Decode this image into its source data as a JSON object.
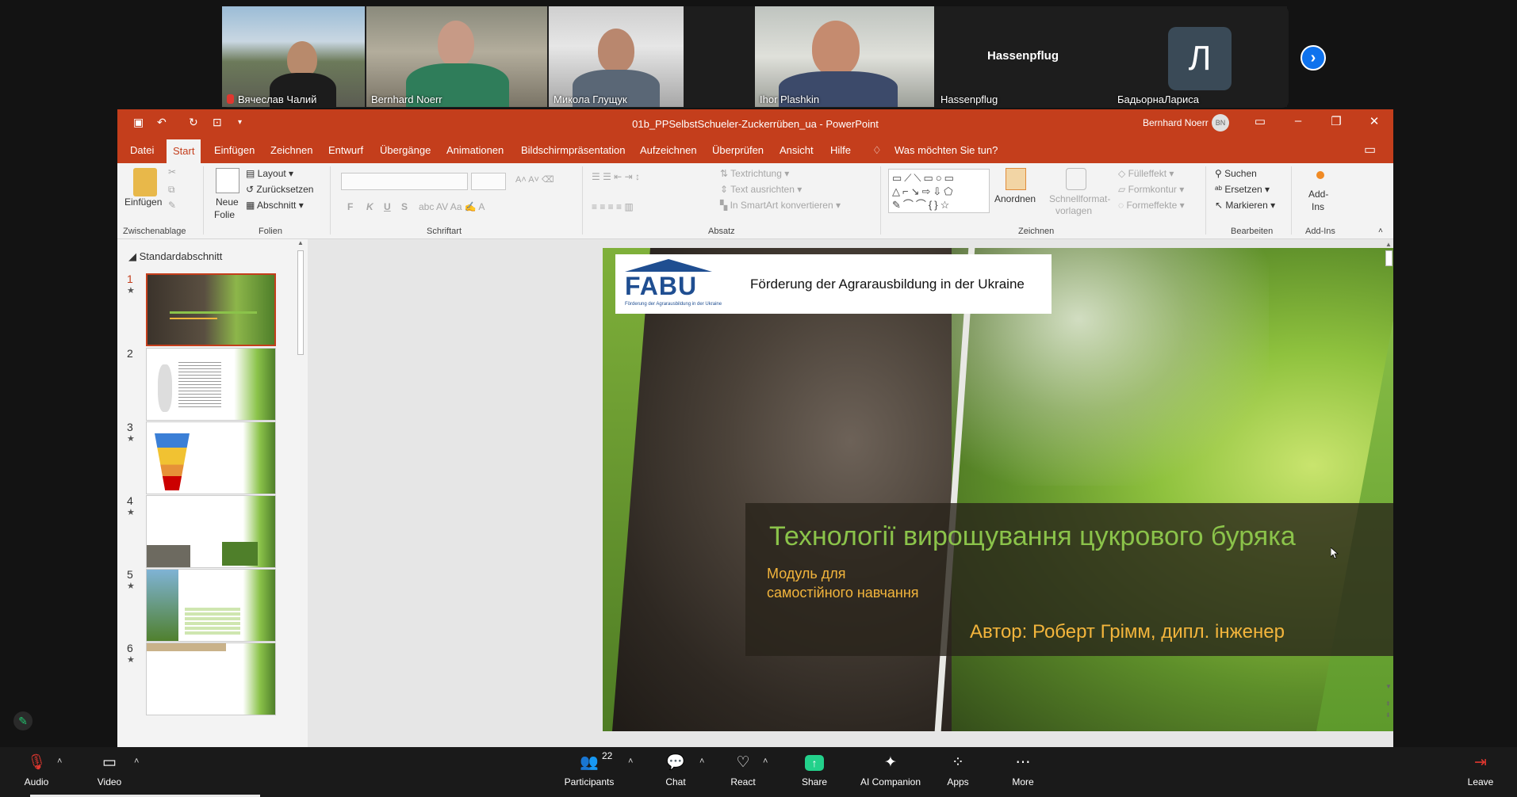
{
  "participants": [
    {
      "name": "Вячеслав Чалий",
      "muted": true
    },
    {
      "name": "Bernhard Noerr"
    },
    {
      "name": "Микола Глущук"
    },
    {
      "name": "Ihor Plashkin",
      "active_speaker": true
    },
    {
      "name": "Hassenpflug",
      "display": "Hassenpflug"
    },
    {
      "name": "БадьорнаЛариса",
      "avatar_letter": "Л"
    }
  ],
  "strip_next_icon": "chevron-right-icon",
  "powerpoint": {
    "doc_title": "01b_PPSelbstSchueler-Zuckerrüben_ua  -  PowerPoint",
    "user": "Bernhard Noerr",
    "user_initials": "BN",
    "tabs": [
      "Datei",
      "Start",
      "Einfügen",
      "Zeichnen",
      "Entwurf",
      "Übergänge",
      "Animationen",
      "Bildschirmpräsentation",
      "Aufzeichnen",
      "Überprüfen",
      "Ansicht",
      "Hilfe"
    ],
    "selected_tab": "Start",
    "tell_me": "Was möchten Sie tun?",
    "ribbon": {
      "paste": "Einfügen",
      "clipboard_group": "Zwischenablage",
      "new_slide_1": "Neue",
      "new_slide_2": "Folie",
      "layout": "Layout",
      "reset": "Zurücksetzen",
      "section": "Abschnitt",
      "slides_group": "Folien",
      "font_group": "Schriftart",
      "bold": "F",
      "italic": "K",
      "underline": "U",
      "strike": "S",
      "text_direction": "Textrichtung",
      "align_text": "Text ausrichten",
      "smartart": "In SmartArt konvertieren",
      "paragraph_group": "Absatz",
      "arrange": "Anordnen",
      "quick_styles_1": "Schnellformat-",
      "quick_styles_2": "vorlagen",
      "fill": "Fülleffekt",
      "outline": "Formkontur",
      "effects": "Formeffekte",
      "drawing_group": "Zeichnen",
      "find": "Suchen",
      "replace": "Ersetzen",
      "select": "Markieren",
      "editing_group": "Bearbeiten",
      "addins_1": "Add-",
      "addins_2": "Ins",
      "addins_group": "Add-Ins"
    },
    "section_name": "Standardabschnitt",
    "thumbnails": [
      "1",
      "2",
      "3",
      "4",
      "5",
      "6"
    ],
    "slide": {
      "logo": "FABU",
      "logo_sub": "Förderung der Agrarausbildung in der Ukraine",
      "header": "Förderung der Agrarausbildung in der Ukraine",
      "title": "Технології вирощування цукрового буряка",
      "subtitle_1": "Модуль для",
      "subtitle_2": "самостійного навчання",
      "author": "Автор: Роберт Грімм, дипл. інженер"
    }
  },
  "toolbar": {
    "audio": "Audio",
    "video": "Video",
    "participants": "Participants",
    "participant_count": "22",
    "chat": "Chat",
    "react": "React",
    "share": "Share",
    "ai": "AI Companion",
    "apps": "Apps",
    "more": "More",
    "leave": "Leave"
  },
  "colors": {
    "ppt_accent": "#c43e1c",
    "share_green": "#23d18b",
    "zoom_blue": "#0e72ed",
    "slide_green": "#8bc34a",
    "slide_gold": "#f3b53c"
  }
}
